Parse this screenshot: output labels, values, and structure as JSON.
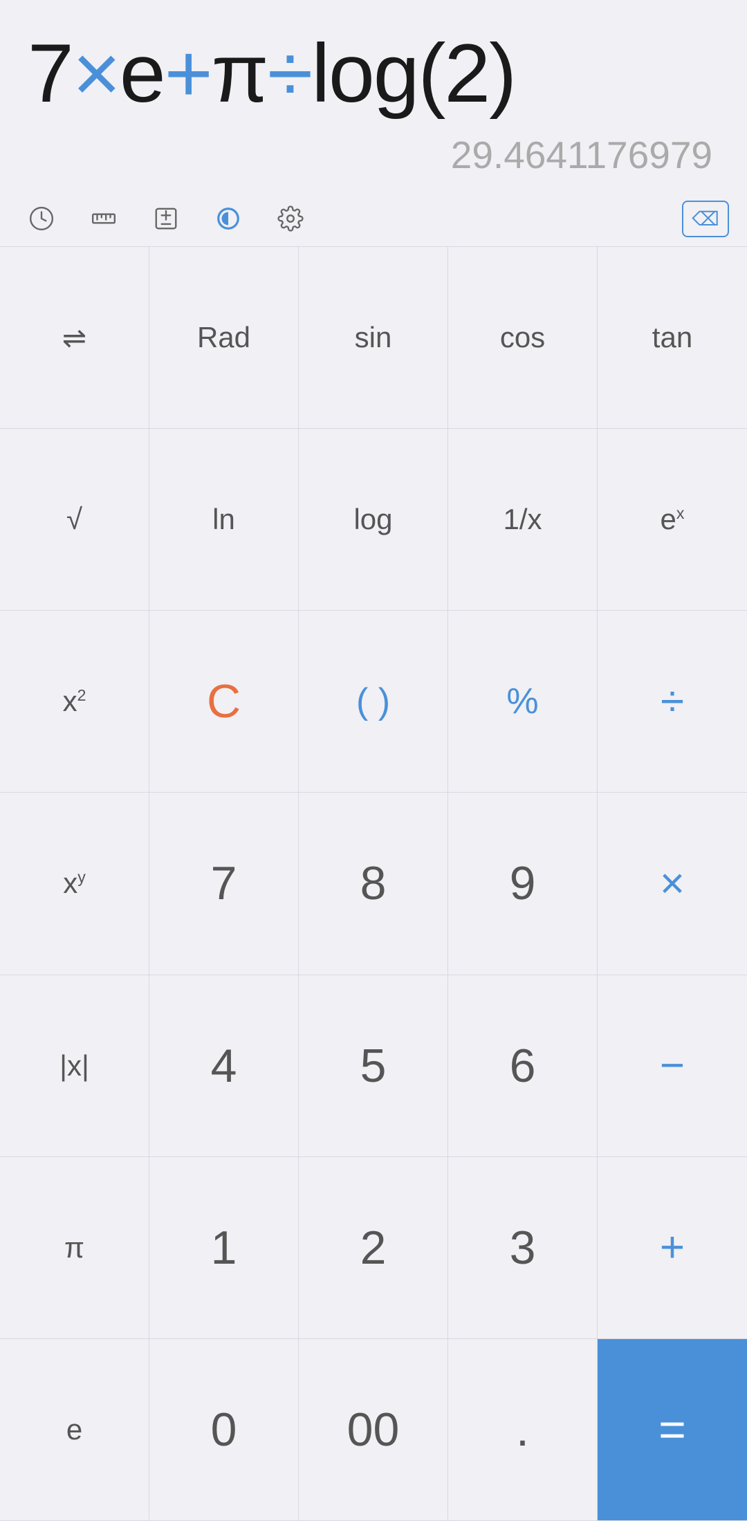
{
  "display": {
    "expression": "7×e+π÷log(2)",
    "expression_parts": [
      {
        "text": "7",
        "type": "normal"
      },
      {
        "text": "×",
        "type": "blue"
      },
      {
        "text": "e",
        "type": "normal"
      },
      {
        "text": "+",
        "type": "blue"
      },
      {
        "text": "π",
        "type": "normal"
      },
      {
        "text": "÷",
        "type": "blue"
      },
      {
        "text": "log(2)",
        "type": "normal"
      }
    ],
    "result": "29.4641176979"
  },
  "toolbar": {
    "history_label": "history",
    "ruler_label": "ruler",
    "plusminus_label": "plus-minus",
    "theme_label": "theme",
    "settings_label": "settings",
    "backspace_label": "backspace"
  },
  "buttons": {
    "row1": [
      {
        "label": "⇌",
        "type": "normal",
        "name": "convert"
      },
      {
        "label": "Rad",
        "type": "normal",
        "name": "rad"
      },
      {
        "label": "sin",
        "type": "normal",
        "name": "sin"
      },
      {
        "label": "cos",
        "type": "normal",
        "name": "cos"
      },
      {
        "label": "tan",
        "type": "normal",
        "name": "tan"
      }
    ],
    "row2": [
      {
        "label": "√",
        "type": "normal",
        "name": "sqrt"
      },
      {
        "label": "ln",
        "type": "normal",
        "name": "ln"
      },
      {
        "label": "log",
        "type": "normal",
        "name": "log"
      },
      {
        "label": "1/x",
        "type": "normal",
        "name": "reciprocal"
      },
      {
        "label": "eˣ",
        "type": "normal",
        "name": "exp"
      }
    ],
    "row3": [
      {
        "label": "x²",
        "type": "normal",
        "name": "square"
      },
      {
        "label": "C",
        "type": "red",
        "name": "clear"
      },
      {
        "label": "( )",
        "type": "blue",
        "name": "parentheses"
      },
      {
        "label": "%",
        "type": "blue",
        "name": "percent"
      },
      {
        "label": "÷",
        "type": "blue-op",
        "name": "divide"
      }
    ],
    "row4": [
      {
        "label": "xʸ",
        "type": "normal",
        "name": "power"
      },
      {
        "label": "7",
        "type": "large",
        "name": "7"
      },
      {
        "label": "8",
        "type": "large",
        "name": "8"
      },
      {
        "label": "9",
        "type": "large",
        "name": "9"
      },
      {
        "label": "×",
        "type": "blue-op",
        "name": "multiply"
      }
    ],
    "row5": [
      {
        "label": "|x|",
        "type": "normal",
        "name": "abs"
      },
      {
        "label": "4",
        "type": "large",
        "name": "4"
      },
      {
        "label": "5",
        "type": "large",
        "name": "5"
      },
      {
        "label": "6",
        "type": "large",
        "name": "6"
      },
      {
        "label": "−",
        "type": "blue-op",
        "name": "subtract"
      }
    ],
    "row6": [
      {
        "label": "π",
        "type": "normal",
        "name": "pi"
      },
      {
        "label": "1",
        "type": "large",
        "name": "1"
      },
      {
        "label": "2",
        "type": "large",
        "name": "2"
      },
      {
        "label": "3",
        "type": "large",
        "name": "3"
      },
      {
        "label": "+",
        "type": "blue-op",
        "name": "add"
      }
    ],
    "row7": [
      {
        "label": "e",
        "type": "normal",
        "name": "euler"
      },
      {
        "label": "0",
        "type": "large",
        "name": "0"
      },
      {
        "label": "00",
        "type": "large",
        "name": "double-zero"
      },
      {
        "label": ".",
        "type": "large",
        "name": "decimal"
      },
      {
        "label": "=",
        "type": "equals",
        "name": "equals"
      }
    ]
  }
}
